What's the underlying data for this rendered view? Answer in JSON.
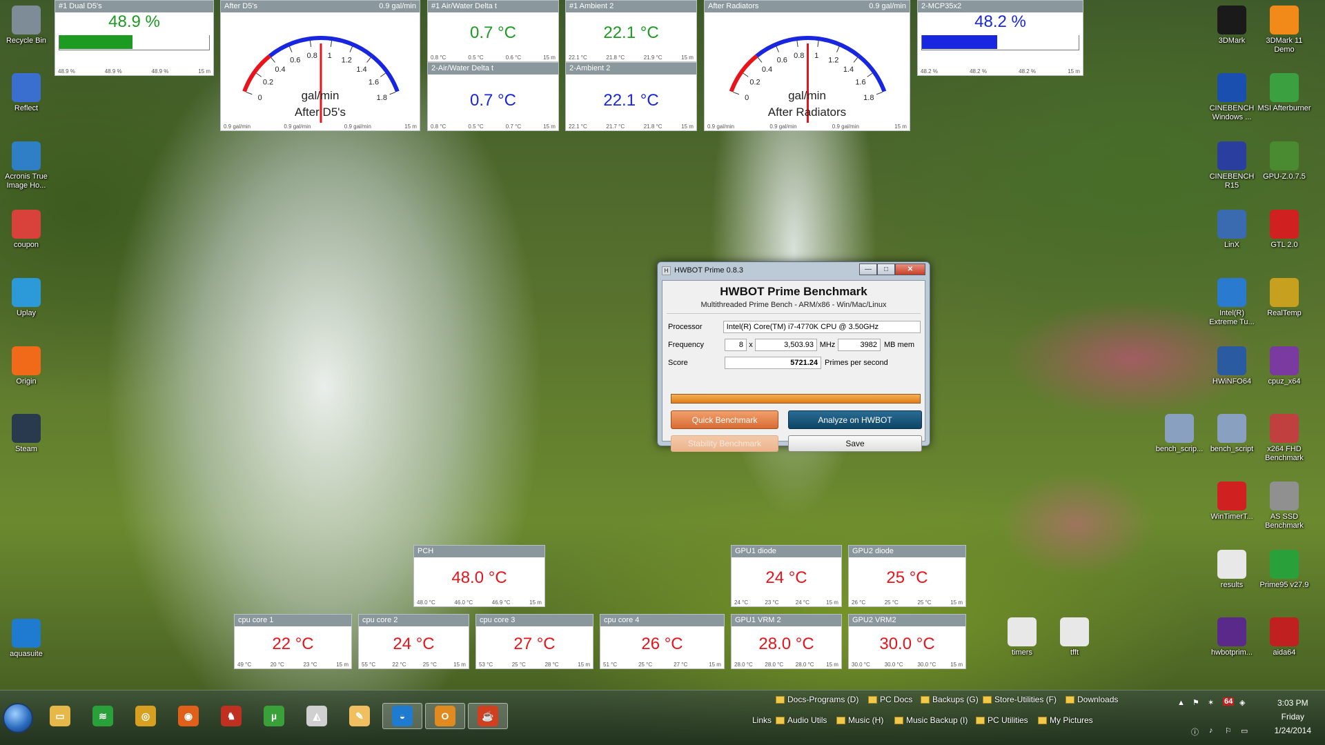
{
  "gadgets": {
    "dual_d5": {
      "title": "#1 Dual D5's",
      "value": "48.9 %",
      "fill": 0.489,
      "color": "#1c9a22",
      "foot": [
        "48.9 %",
        "48.9 %",
        "48.9 %",
        "15 m"
      ]
    },
    "mcp35x2": {
      "title": "2-MCP35x2",
      "value": "48.2 %",
      "fill": 0.482,
      "color": "#1826e0",
      "foot": [
        "48.2 %",
        "48.2 %",
        "48.2 %",
        "15 m"
      ]
    },
    "air_water_1": {
      "title": "#1 Air/Water Delta t",
      "value": "0.7 °C",
      "foot": [
        "0.8 °C",
        "0.5 °C",
        "0.6 °C",
        "15 m"
      ]
    },
    "air_water_2": {
      "title": "2-Air/Water Delta t",
      "value": "0.7 °C",
      "foot": [
        "0.8 °C",
        "0.5 °C",
        "0.7 °C",
        "15 m"
      ]
    },
    "ambient_1": {
      "title": "#1 Ambient 2",
      "value": "22.1 °C",
      "foot": [
        "22.1 °C",
        "21.8 °C",
        "21.9 °C",
        "15 m"
      ]
    },
    "ambient_2": {
      "title": "2-Ambient 2",
      "value": "22.1 °C",
      "foot": [
        "22.1 °C",
        "21.7 °C",
        "21.8 °C",
        "15 m"
      ]
    },
    "pch": {
      "title": "PCH",
      "value": "48.0 °C",
      "foot": [
        "48.0 °C",
        "46.0 °C",
        "46.9 °C",
        "15 m"
      ]
    },
    "gpu1_diode": {
      "title": "GPU1 diode",
      "value": "24 °C",
      "foot": [
        "24 °C",
        "23 °C",
        "24 °C",
        "15 m"
      ]
    },
    "gpu2_diode": {
      "title": "GPU2 diode",
      "value": "25 °C",
      "foot": [
        "26 °C",
        "25 °C",
        "25 °C",
        "15 m"
      ]
    },
    "cpu_core_1": {
      "title": "cpu core 1",
      "value": "22 °C",
      "foot": [
        "49 °C",
        "20 °C",
        "23 °C",
        "15 m"
      ]
    },
    "cpu_core_2": {
      "title": "cpu core 2",
      "value": "24 °C",
      "foot": [
        "55 °C",
        "22 °C",
        "25 °C",
        "15 m"
      ]
    },
    "cpu_core_3": {
      "title": "cpu core 3",
      "value": "27 °C",
      "foot": [
        "53 °C",
        "25 °C",
        "28 °C",
        "15 m"
      ]
    },
    "cpu_core_4": {
      "title": "cpu core 4",
      "value": "26 °C",
      "foot": [
        "51 °C",
        "25 °C",
        "27 °C",
        "15 m"
      ]
    },
    "gpu1_vrm2": {
      "title": "GPU1 VRM 2",
      "value": "28.0 °C",
      "foot": [
        "28.0 °C",
        "28.0 °C",
        "28.0 °C",
        "15 m"
      ]
    },
    "gpu2_vrm2": {
      "title": "GPU2 VRM2",
      "value": "30.0 °C",
      "foot": [
        "30.0 °C",
        "30.0 °C",
        "30.0 °C",
        "15 m"
      ]
    }
  },
  "gauges": {
    "after_d5": {
      "title": "After D5's",
      "value_text": "0.9 gal/min",
      "value": 0.9,
      "unit": "gal/min",
      "caption": "After D5's",
      "ticks": [
        "0",
        "0.2",
        "0.4",
        "0.6",
        "0.8",
        "1",
        "1.2",
        "1.4",
        "1.6",
        "1.8"
      ],
      "foot": [
        "0.9 gal/min",
        "0.9 gal/min",
        "0.9 gal/min",
        "15 m"
      ]
    },
    "after_radiators": {
      "title": "After Radiators",
      "value_text": "0.9 gal/min",
      "value": 0.9,
      "unit": "gal/min",
      "caption": "After Radiators",
      "ticks": [
        "0",
        "0.2",
        "0.4",
        "0.6",
        "0.8",
        "1",
        "1.2",
        "1.4",
        "1.6",
        "1.8"
      ],
      "foot": [
        "0.9 gal/min",
        "0.9 gal/min",
        "0.9 gal/min",
        "15 m"
      ]
    }
  },
  "desktop_left": [
    {
      "label": "Recycle Bin",
      "icon": "recycle-bin-icon",
      "color": "#7d8c96"
    },
    {
      "label": "Reflect",
      "icon": "reflect-icon",
      "color": "#3a6fd0"
    },
    {
      "label": "Acronis True Image Ho...",
      "icon": "acronis-icon",
      "color": "#2f7fc7"
    },
    {
      "label": "coupon",
      "icon": "coupon-icon",
      "color": "#d9423a"
    },
    {
      "label": "Uplay",
      "icon": "uplay-icon",
      "color": "#2c9ad8"
    },
    {
      "label": "Origin",
      "icon": "origin-icon",
      "color": "#f06a1a"
    },
    {
      "label": "Steam",
      "icon": "steam-icon",
      "color": "#2a3a4e"
    },
    {
      "label": "aquasuite",
      "icon": "aquasuite-icon",
      "color": "#1e7bd0"
    }
  ],
  "desktop_right": [
    {
      "label": "3DMark",
      "icon": "3dmark-icon",
      "color": "#1a1a1a"
    },
    {
      "label": "3DMark 11 Demo",
      "icon": "3dmark11-icon",
      "color": "#f28a1a"
    },
    {
      "label": "CINEBENCH Windows ...",
      "icon": "cinebench-icon",
      "color": "#1a4fb0"
    },
    {
      "label": "MSI Afterburner",
      "icon": "msi-afterburner-icon",
      "color": "#3aa040"
    },
    {
      "label": "CINEBENCH R15",
      "icon": "cinebench-r15-icon",
      "color": "#2a3ea0"
    },
    {
      "label": "GPU-Z.0.7.5",
      "icon": "gpuz-icon",
      "color": "#4a8a30"
    },
    {
      "label": "LinX",
      "icon": "linx-icon",
      "color": "#3a6ab0"
    },
    {
      "label": "GTL 2.0",
      "icon": "gtl-icon",
      "color": "#d02020"
    },
    {
      "label": "Intel(R) Extreme Tu...",
      "icon": "intel-xtu-icon",
      "color": "#2a7ad0"
    },
    {
      "label": "RealTemp",
      "icon": "realtemp-icon",
      "color": "#c8a020"
    },
    {
      "label": "HWiNFO64",
      "icon": "hwinfo-icon",
      "color": "#2a5aa0"
    },
    {
      "label": "cpuz_x64",
      "icon": "cpuz-icon",
      "color": "#7a3aa0"
    },
    {
      "label": "bench_scrip...",
      "icon": "bench-script-icon",
      "color": "#8aa0c0"
    },
    {
      "label": "bench_script",
      "icon": "bench-script-2-icon",
      "color": "#8aa0c0"
    },
    {
      "label": "x264 FHD Benchmark",
      "icon": "x264-icon",
      "color": "#c04040"
    },
    {
      "label": "WinTimerT...",
      "icon": "wintimer-icon",
      "color": "#d02020"
    },
    {
      "label": "AS SSD Benchmark",
      "icon": "as-ssd-icon",
      "color": "#909090"
    },
    {
      "label": "results",
      "icon": "results-file-icon",
      "color": "#e8e8e8"
    },
    {
      "label": "Prime95 v27.9",
      "icon": "prime95-icon",
      "color": "#2aa03a"
    },
    {
      "label": "hwbotprim...",
      "icon": "hwbotprime-icon",
      "color": "#5a2a8a"
    },
    {
      "label": "aida64",
      "icon": "aida64-icon",
      "color": "#c02020"
    },
    {
      "label": "timers",
      "icon": "timers-file-icon",
      "color": "#e8e8e8"
    },
    {
      "label": "tfft",
      "icon": "tfft-file-icon",
      "color": "#e8e8e8"
    }
  ],
  "hwbot": {
    "window_title": "HWBOT Prime 0.8.3",
    "heading": "HWBOT Prime Benchmark",
    "subheading": "Multithreaded Prime Bench - ARM/x86 - Win/Mac/Linux",
    "processor_label": "Processor",
    "processor_value": "Intel(R) Core(TM) i7-4770K CPU @ 3.50GHz",
    "frequency_label": "Frequency",
    "threads": "8",
    "times": "x",
    "mhz_value": "3,503.93",
    "mhz_unit": "MHz",
    "mem_value": "3982",
    "mem_unit": "MB mem",
    "score_label": "Score",
    "score_value": "5721.24",
    "score_unit": "Primes per second",
    "progress": 1.0,
    "quick_benchmark": "Quick Benchmark",
    "analyze": "Analyze on HWBOT",
    "stability": "Stability Benchmark",
    "save": "Save",
    "min_glyph": "—",
    "max_glyph": "□",
    "close_glyph": "✕",
    "app_glyph": "H"
  },
  "taskbar": {
    "apps": [
      {
        "icon": "file-explorer-icon",
        "color": "#e6b84a",
        "glyph": "▭"
      },
      {
        "icon": "spotify-icon",
        "color": "#2aa03a",
        "glyph": "≋"
      },
      {
        "icon": "chrome-canary-icon",
        "color": "#d8a020",
        "glyph": "◎"
      },
      {
        "icon": "firefox-icon",
        "color": "#e0601a",
        "glyph": "◉"
      },
      {
        "icon": "game-app-icon",
        "color": "#c03020",
        "glyph": "♞"
      },
      {
        "icon": "utorrent-icon",
        "color": "#3aa03a",
        "glyph": "µ"
      },
      {
        "icon": "mask-app-icon",
        "color": "#d0d0d0",
        "glyph": "◭"
      },
      {
        "icon": "notes-app-icon",
        "color": "#f0c060",
        "glyph": "✎"
      },
      {
        "icon": "aquasuite-taskbar-icon",
        "color": "#1e7bd0",
        "glyph": "◒"
      },
      {
        "icon": "outlook-icon",
        "color": "#e08a20",
        "glyph": "O"
      },
      {
        "icon": "java-icon",
        "color": "#d04020",
        "glyph": "☕"
      }
    ],
    "links_label": "Links",
    "folders_row1": [
      "Docs-Programs (D)",
      "PC Docs",
      "Backups (G)",
      "Store-Utilities (F)",
      "Downloads"
    ],
    "folders_row2": [
      "Audio Utils",
      "Music (H)",
      "Music Backup (I)",
      "PC Utilities",
      "My Pictures"
    ],
    "tray_badge": "64",
    "time": "3:03 PM",
    "day": "Friday",
    "date": "1/24/2014"
  }
}
